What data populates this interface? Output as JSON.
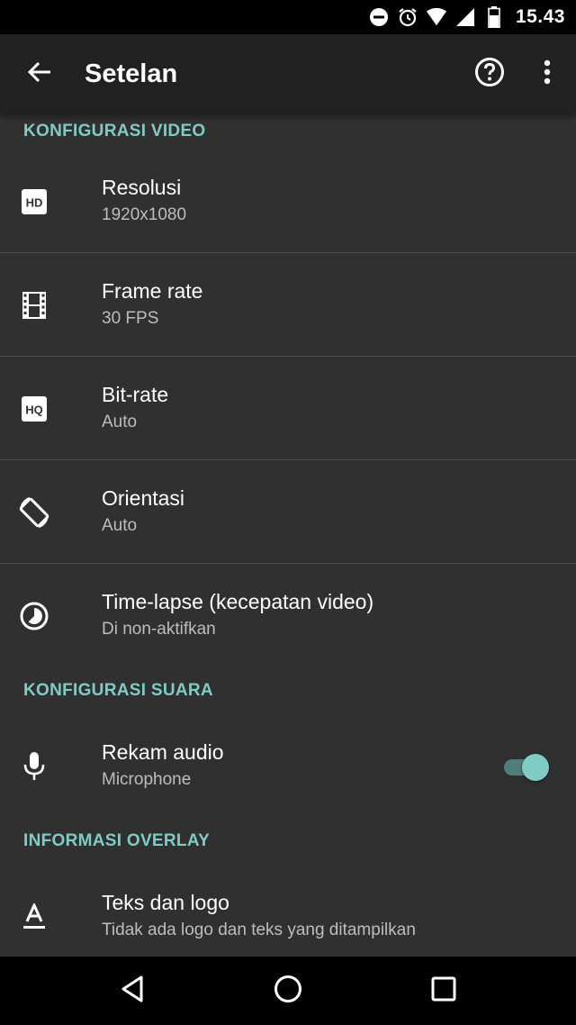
{
  "status_bar": {
    "time": "15.43",
    "icons": [
      "do-not-disturb-icon",
      "alarm-icon",
      "wifi-icon",
      "signal-icon",
      "battery-icon"
    ]
  },
  "app_bar": {
    "title": "Setelan",
    "icons": [
      "back-arrow-icon",
      "help-icon",
      "more-vert-icon"
    ]
  },
  "sections": {
    "video": {
      "header": "KONFIGURASI VIDEO",
      "items": [
        {
          "title": "Resolusi",
          "subtitle": "1920x1080",
          "icon": "hd-icon"
        },
        {
          "title": "Frame rate",
          "subtitle": "30 FPS",
          "icon": "film-icon"
        },
        {
          "title": "Bit-rate",
          "subtitle": "Auto",
          "icon": "hq-icon"
        },
        {
          "title": "Orientasi",
          "subtitle": "Auto",
          "icon": "screen-rotation-icon"
        },
        {
          "title": "Time-lapse (kecepatan video)",
          "subtitle": "Di non-aktifkan",
          "icon": "timelapse-icon"
        }
      ]
    },
    "audio": {
      "header": "KONFIGURASI SUARA",
      "items": [
        {
          "title": "Rekam audio",
          "subtitle": "Microphone",
          "icon": "mic-icon",
          "toggle_on": true
        }
      ]
    },
    "overlay": {
      "header": "INFORMASI OVERLAY",
      "items": [
        {
          "title": "Teks dan logo",
          "subtitle": "Tidak ada logo dan teks yang ditampilkan",
          "icon": "text-format-icon"
        }
      ]
    }
  },
  "nav_bar": {
    "icons": [
      "back-triangle-icon",
      "home-circle-icon",
      "recents-square-icon"
    ]
  },
  "colors": {
    "accent": "#80cbc4",
    "background": "#303030",
    "app_bar": "#212121"
  }
}
